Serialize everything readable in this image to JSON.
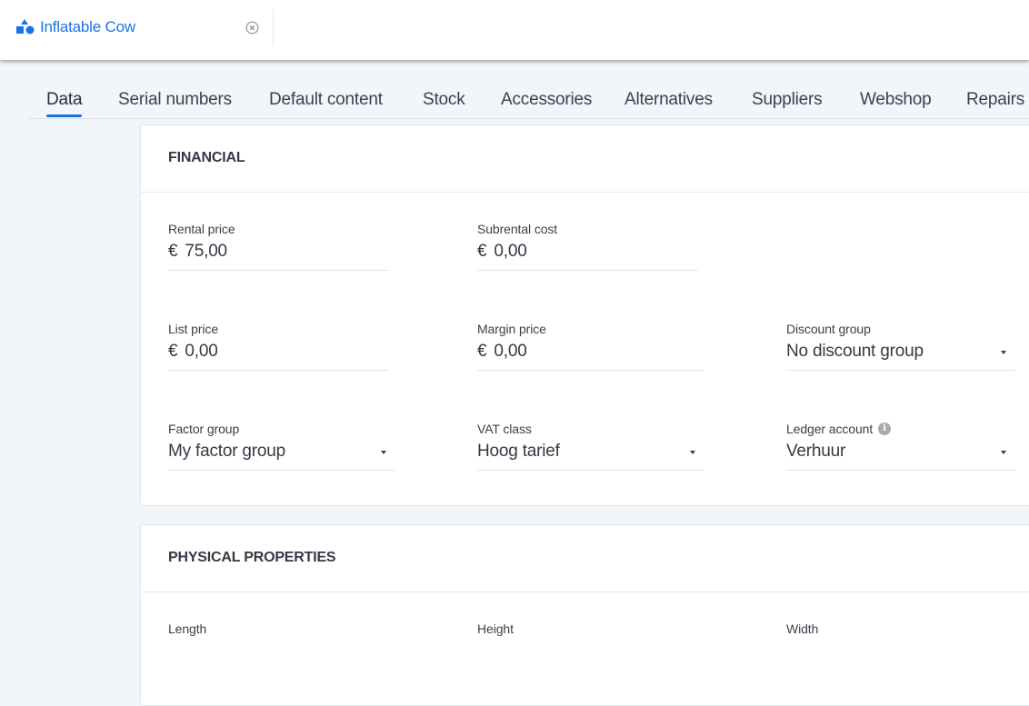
{
  "document_tab": {
    "title": "Inflatable Cow",
    "icon": "shapes-icon",
    "close_icon": "close-circle-icon",
    "accent_color": "#1a73e8"
  },
  "tabs": [
    {
      "label": "Data",
      "active": true
    },
    {
      "label": "Serial numbers",
      "active": false
    },
    {
      "label": "Default content",
      "active": false
    },
    {
      "label": "Stock",
      "active": false
    },
    {
      "label": "Accessories",
      "active": false
    },
    {
      "label": "Alternatives",
      "active": false
    },
    {
      "label": "Suppliers",
      "active": false
    },
    {
      "label": "Webshop",
      "active": false
    },
    {
      "label": "Repairs",
      "active": false
    }
  ],
  "financial": {
    "title": "FINANCIAL",
    "fields": {
      "rental_price": {
        "label": "Rental price",
        "currency": "€",
        "value": "75,00"
      },
      "subrental_cost": {
        "label": "Subrental cost",
        "currency": "€",
        "value": "0,00"
      },
      "list_price": {
        "label": "List price",
        "currency": "€",
        "value": "0,00"
      },
      "margin_price": {
        "label": "Margin price",
        "currency": "€",
        "value": "0,00"
      },
      "discount_group": {
        "label": "Discount group",
        "value": "No discount group"
      },
      "factor_group": {
        "label": "Factor group",
        "value": "My factor group"
      },
      "vat_class": {
        "label": "VAT class",
        "value": "Hoog tarief"
      },
      "ledger_account": {
        "label": "Ledger account",
        "value": "Verhuur",
        "info_icon": "info-icon"
      }
    }
  },
  "physical": {
    "title": "PHYSICAL PROPERTIES",
    "fields": {
      "length": {
        "label": "Length"
      },
      "height": {
        "label": "Height"
      },
      "width": {
        "label": "Width"
      }
    }
  }
}
